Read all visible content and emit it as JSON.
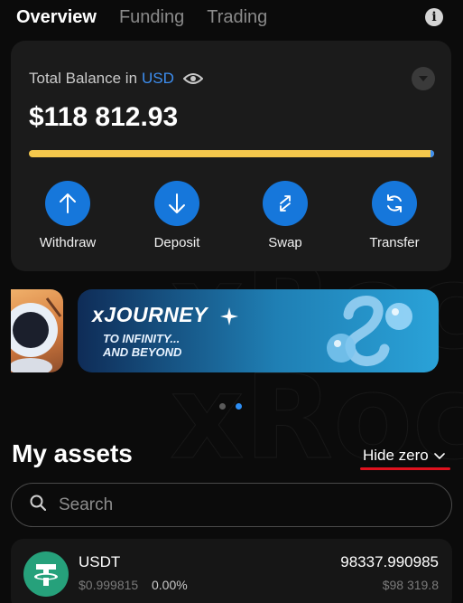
{
  "tabs": [
    {
      "label": "Overview",
      "active": true
    },
    {
      "label": "Funding",
      "active": false
    },
    {
      "label": "Trading",
      "active": false
    }
  ],
  "icons": {
    "info": "info-icon",
    "eye": "eye-icon",
    "dropdown": "chevron-down-icon",
    "search": "search-icon"
  },
  "balance": {
    "label": "Total Balance in",
    "currency": "USD",
    "amount": "$118 812.93",
    "bar_colors": [
      "#f5c84c",
      "#3d8ef0"
    ]
  },
  "actions": [
    {
      "label": "Withdraw",
      "icon": "arrow-up-icon"
    },
    {
      "label": "Deposit",
      "icon": "arrow-down-icon"
    },
    {
      "label": "Swap",
      "icon": "swap-icon"
    },
    {
      "label": "Transfer",
      "icon": "refresh-icon"
    }
  ],
  "banner": {
    "title": "xJOURNEY",
    "subtitle_line1": "TO INFINITY...",
    "subtitle_line2": "AND BEYOND"
  },
  "carousel": {
    "total": 2,
    "active_index": 1
  },
  "watermark": "xRoc",
  "assets": {
    "title": "My assets",
    "hide_zero_label": "Hide zero",
    "search_placeholder": "Search",
    "items": [
      {
        "name": "USDT",
        "price": "$0.999815",
        "change": "0.00%",
        "amount": "98337.990985",
        "value": "$98 319.8",
        "icon": "tether-icon"
      }
    ]
  },
  "colors": {
    "accent": "#1677db",
    "card_bg": "#1b1b1b",
    "highlight_underline": "#e0121e",
    "tether_green": "#26a17b"
  }
}
